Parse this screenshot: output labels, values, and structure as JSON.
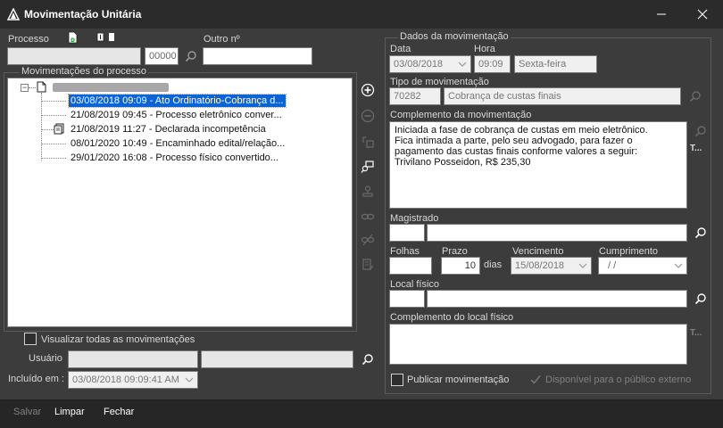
{
  "window": {
    "title": "Movimentação Unitária"
  },
  "left": {
    "processo_label": "Processo",
    "processo_suffix": "00000",
    "outro_label": "Outro nº",
    "movimentacoes_label": "Movimentações do processo",
    "tree_items": [
      {
        "text": "03/08/2018 09:09 - Ato Ordinatório-Cobrança d...",
        "selected": true
      },
      {
        "text": "21/08/2019 09:45 - Processo eletrônico conver...",
        "selected": false
      },
      {
        "text": "21/08/2019 11:27 - Declarada incompetência",
        "selected": false
      },
      {
        "text": "08/01/2020 10:49 - Encaminhado edital/relação...",
        "selected": false
      },
      {
        "text": "29/01/2020 16:08 - Processo físico convertido...",
        "selected": false
      }
    ],
    "visualizar_label": "Visualizar todas as movimentações",
    "usuario_label": "Usuário",
    "incluido_label": "Incluído em :",
    "incluido_value": "03/08/2018 09:09:41 AM"
  },
  "right": {
    "group_title": "Dados da movimentação",
    "data_label": "Data",
    "data_value": "03/08/2018",
    "hora_label": "Hora",
    "hora_value": "09:09",
    "dia_value": "Sexta-feira",
    "tipo_label": "Tipo de movimentação",
    "tipo_code": "70282",
    "tipo_desc": "Cobrança de custas finais",
    "complemento_label": "Complemento da movimentação",
    "complemento_text": "Iniciada a fase de cobrança de custas em meio eletrônico.\nFica intimada a parte, pelo seu advogado, para fazer o\npagamento das custas finais conforme valores a seguir:\nTrivilano Posseidon, R$ 235,30",
    "text_tool": "T...",
    "magistrado_label": "Magistrado",
    "folhas_label": "Folhas",
    "prazo_label": "Prazo",
    "prazo_value": "10",
    "dias_label": "dias",
    "vencimento_label": "Vencimento",
    "vencimento_value": "15/08/2018",
    "cumprimento_label": "Cumprimento",
    "cumprimento_value": "/ /",
    "local_label": "Local físico",
    "complemento_local_label": "Complemento do local físico",
    "publicar_label": "Publicar movimentação",
    "disponivel_label": "Disponível para o público externo"
  },
  "bottom": {
    "salvar": "Salvar",
    "limpar": "Limpar",
    "fechar": "Fechar"
  },
  "colors": {
    "selection": "#0a64d6",
    "window_bg": "#3c3c3c",
    "titlebar_bg": "#2b2b2b"
  }
}
